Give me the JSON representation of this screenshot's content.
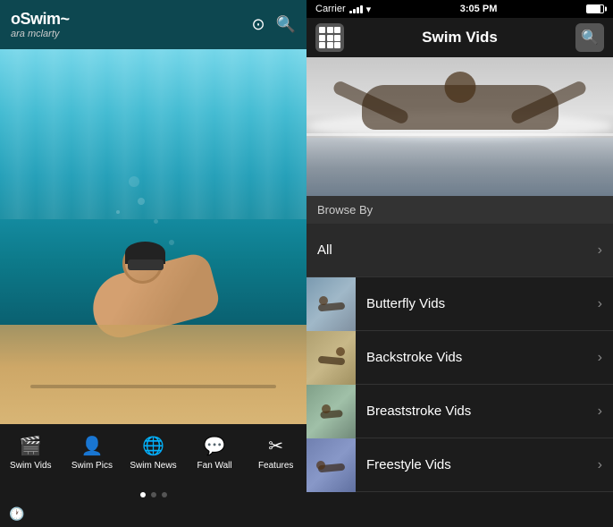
{
  "left": {
    "logo": {
      "top": "oSwim~",
      "sub": "ara mclarty"
    },
    "tabs": [
      {
        "id": "swim-vids",
        "label": "Swim Vids",
        "icon": "🎬"
      },
      {
        "id": "swim-pics",
        "label": "Swim Pics",
        "icon": "👤"
      },
      {
        "id": "swim-news",
        "label": "Swim News",
        "icon": "🌐"
      },
      {
        "id": "fan-wall",
        "label": "Fan Wall",
        "icon": "💬"
      },
      {
        "id": "features",
        "label": "Features",
        "icon": "✂"
      }
    ],
    "dots": [
      true,
      false,
      false
    ],
    "footer_icon": "🕐"
  },
  "right": {
    "status_bar": {
      "carrier": "Carrier",
      "time": "3:05 PM"
    },
    "nav": {
      "title": "Swim Vids"
    },
    "browse_by_label": "Browse By",
    "list_items": [
      {
        "id": "all",
        "label": "All",
        "has_thumb": false
      },
      {
        "id": "butterfly",
        "label": "Butterfly Vids",
        "has_thumb": true,
        "thumb_type": "butterfly"
      },
      {
        "id": "backstroke",
        "label": "Backstroke Vids",
        "has_thumb": true,
        "thumb_type": "backstroke"
      },
      {
        "id": "breaststroke",
        "label": "Breaststroke Vids",
        "has_thumb": true,
        "thumb_type": "breaststroke"
      },
      {
        "id": "freestyle",
        "label": "Freestyle Vids",
        "has_thumb": true,
        "thumb_type": "freestyle"
      }
    ],
    "chevron": "›"
  }
}
